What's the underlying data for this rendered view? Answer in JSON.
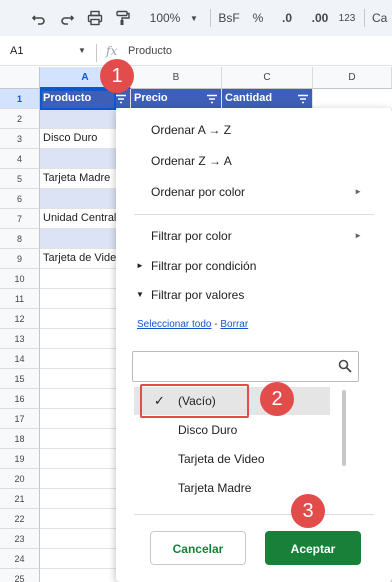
{
  "toolbar": {
    "zoom": "100%",
    "currency": "BsF",
    "percent": "%",
    "decrease_decimals": ".0",
    "increase_decimals": ".00",
    "number_format": "123",
    "font_partial": "Ca"
  },
  "formula_bar": {
    "cell_ref": "A1",
    "fx": "fx",
    "content": "Producto"
  },
  "columns": [
    "A",
    "B",
    "C",
    "D"
  ],
  "rows": [
    "1",
    "2",
    "3",
    "4",
    "5",
    "6",
    "7",
    "8",
    "9",
    "10",
    "11",
    "12",
    "13",
    "14",
    "15",
    "16",
    "17",
    "18",
    "19",
    "20",
    "21",
    "22",
    "23",
    "24",
    "25"
  ],
  "table": {
    "headers": [
      "Producto",
      "Precio",
      "Cantidad"
    ],
    "col_a": [
      "",
      "Disco Duro",
      "",
      "Tarjeta Madre",
      "",
      "Unidad Central",
      "",
      "Tarjeta de Video"
    ]
  },
  "menu": {
    "sort_az": "Ordenar A → Z",
    "sort_za": "Ordenar Z → A",
    "sort_color": "Ordenar por color",
    "filter_color": "Filtrar por color",
    "filter_condition": "Filtrar por condición",
    "filter_values": "Filtrar por valores",
    "select_all": "Seleccionar todo",
    "link_sep": " - ",
    "clear": "Borrar",
    "search_placeholder": "",
    "values": [
      "(Vacío)",
      "Disco Duro",
      "Tarjeta de Video",
      "Tarjeta Madre"
    ],
    "cancel": "Cancelar",
    "accept": "Aceptar"
  },
  "callouts": [
    "1",
    "2",
    "3"
  ],
  "colors": {
    "header_fill": "#3d5fb8",
    "band_fill": "#dbe3f4",
    "accept_button": "#188038",
    "callout": "#e24c4b",
    "selection": "#0b57d0"
  }
}
